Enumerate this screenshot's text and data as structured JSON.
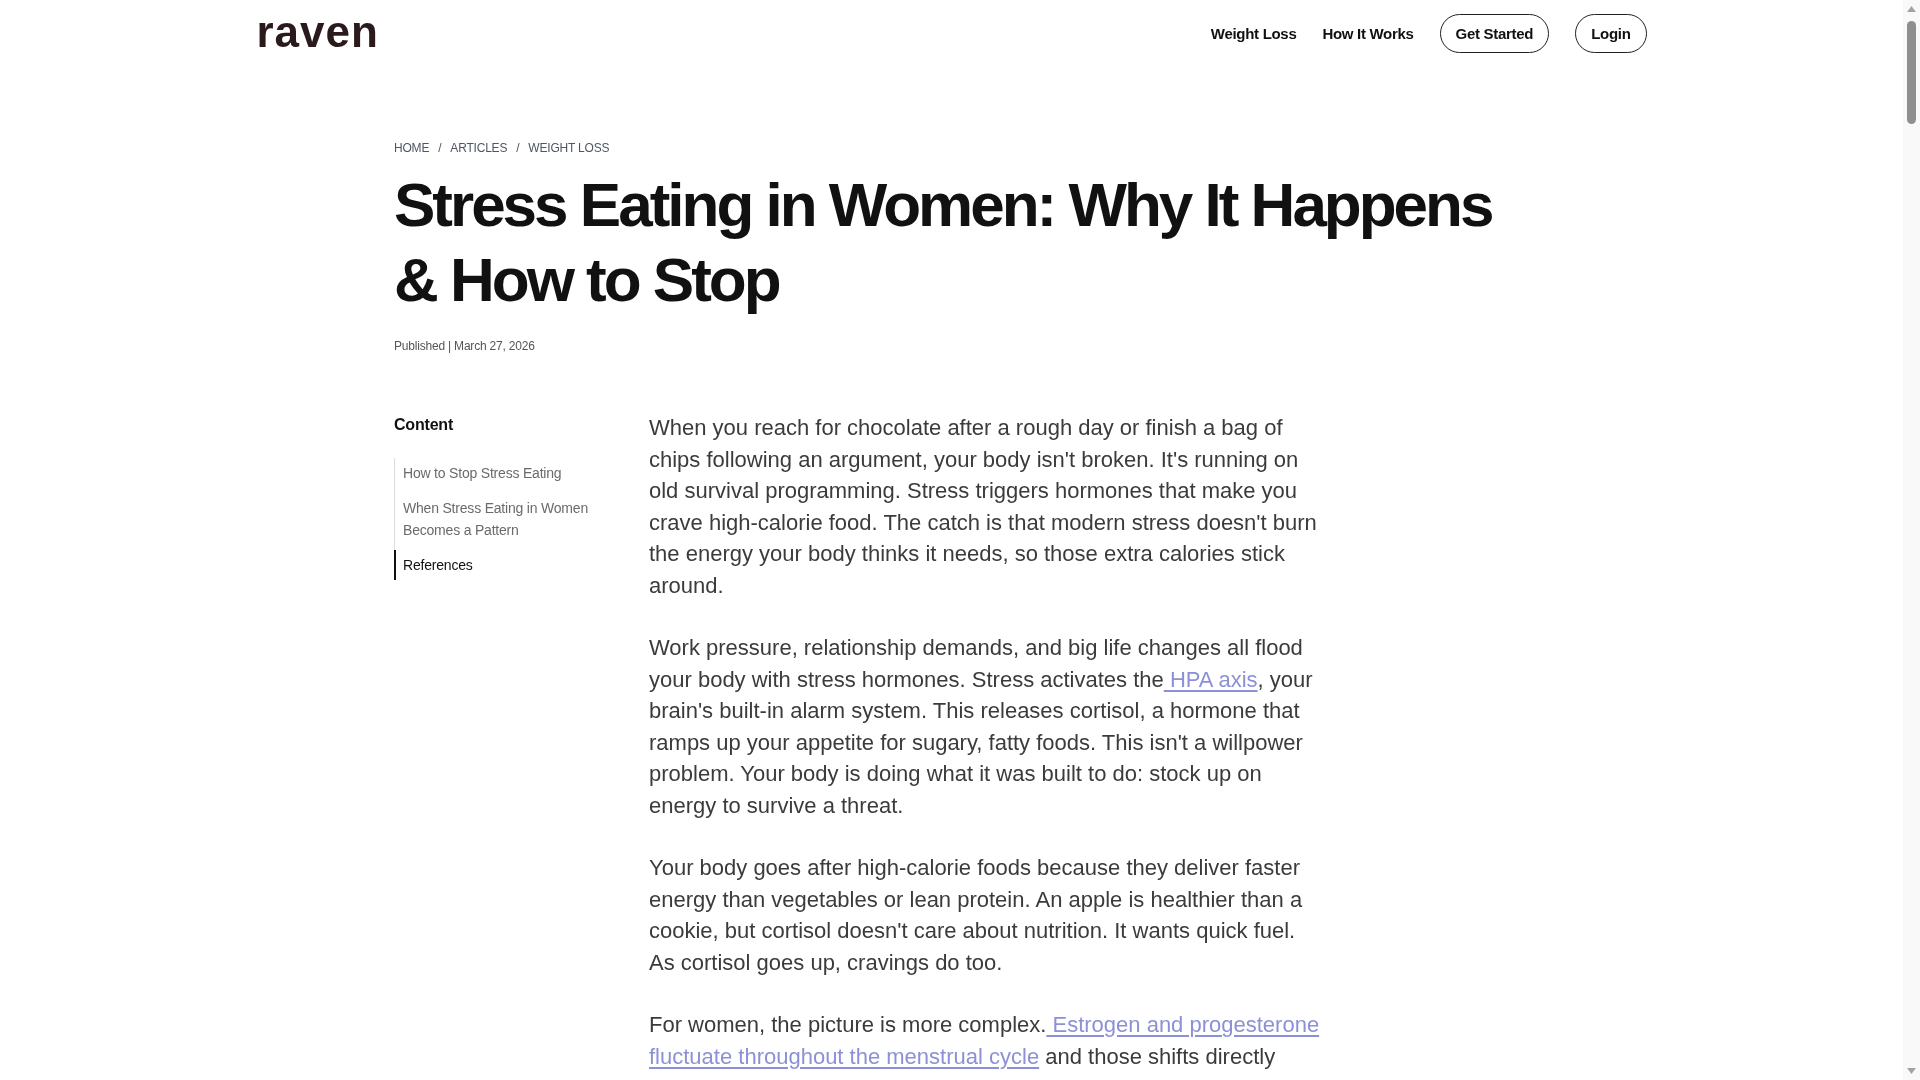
{
  "header": {
    "logo": "raven",
    "nav": [
      {
        "kind": "link",
        "label": "Weight Loss"
      },
      {
        "kind": "link",
        "label": "How It Works"
      },
      {
        "kind": "button",
        "label": "Get Started"
      },
      {
        "kind": "button",
        "label": "Login"
      }
    ]
  },
  "breadcrumb": [
    {
      "text": "HOME",
      "separator": "/"
    },
    {
      "text": "ARTICLES",
      "separator": "/"
    },
    {
      "text": "WEIGHT LOSS"
    }
  ],
  "article": {
    "title": "Stress Eating in Women: Why It Happens & How to Stop",
    "published": "Published | March 27, 2026"
  },
  "toc": {
    "heading": "Content",
    "items": [
      {
        "label": "How to Stop Stress Eating",
        "selected": false
      },
      {
        "label": "When Stress Eating in Women Becomes a Pattern",
        "selected": false
      },
      {
        "label": "References",
        "selected": true
      }
    ]
  },
  "body": {
    "paragraphs": [
      {
        "parts": [
          {
            "kind": "text",
            "text": "When you reach for chocolate after a rough day or finish a bag of chips following an argument, your body isn't broken. It's running on old survival programming. Stress triggers hormones that make you crave high-calorie food. The catch is that modern stress doesn't burn the energy your body thinks it needs, so those extra calories stick around."
          }
        ]
      },
      {
        "parts": [
          {
            "kind": "text",
            "text": "Work pressure, relationship demands, and big life changes all flood your body with stress hormones. Stress activates the"
          },
          {
            "kind": "link",
            "text": " HPA axis"
          },
          {
            "kind": "text",
            "text": ", your brain's built-in alarm system. This releases cortisol, a hormone that ramps up your appetite for sugary, fatty foods. This isn't a willpower problem. Your body is doing what it was built to do: stock up on energy to survive a threat."
          }
        ]
      },
      {
        "parts": [
          {
            "kind": "text",
            "text": "Your body goes after high-calorie foods because they deliver faster energy than vegetables or lean protein. An apple is healthier than a cookie, but cortisol doesn't care about nutrition. It wants quick fuel. As cortisol goes up, cravings do too."
          }
        ]
      },
      {
        "parts": [
          {
            "kind": "text",
            "text": "For women, the picture is more complex."
          },
          {
            "kind": "link",
            "text": " Estrogen and progesterone"
          },
          {
            "kind": "link",
            "text": " fluctuate throughout the menstrual cycle"
          },
          {
            "kind": "text",
            "text": " and those shifts directly"
          }
        ]
      }
    ]
  }
}
